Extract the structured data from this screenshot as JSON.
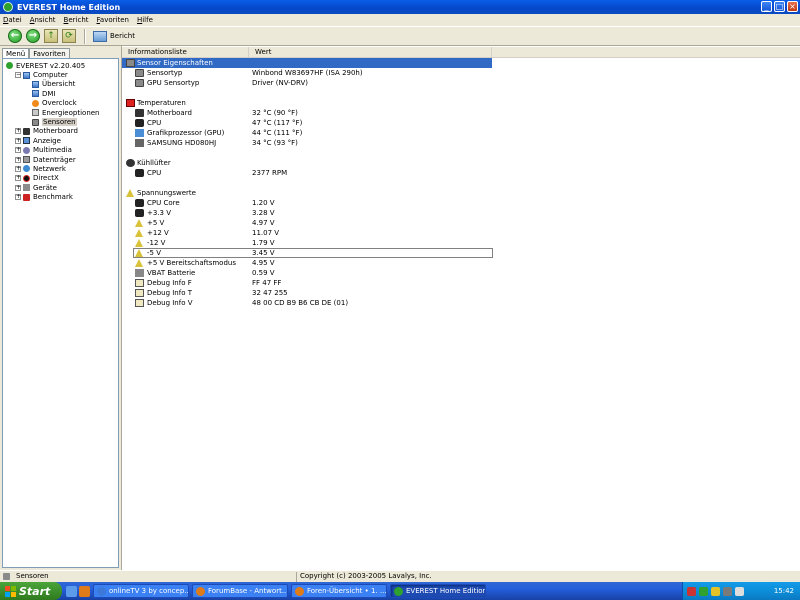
{
  "window": {
    "title": "EVEREST Home Edition",
    "min": "_",
    "max": "□",
    "close": "×"
  },
  "menu": [
    "Datei",
    "Ansicht",
    "Bericht",
    "Favoriten",
    "Hilfe"
  ],
  "toolbar": {
    "back": "←",
    "forward": "→",
    "up": "↑",
    "refresh": "⟳",
    "report_label": "Bericht"
  },
  "left_tabs": [
    "Menü",
    "Favoriten"
  ],
  "tree": [
    {
      "label": "EVEREST v2.20.405",
      "depth": 0,
      "expander": "",
      "icon": "everest-icon"
    },
    {
      "label": "Computer",
      "depth": 1,
      "expander": "−",
      "icon": "computer-icon"
    },
    {
      "label": "Übersicht",
      "depth": 2,
      "expander": "",
      "icon": "computer-icon"
    },
    {
      "label": "DMI",
      "depth": 2,
      "expander": "",
      "icon": "computer-icon"
    },
    {
      "label": "Overclock",
      "depth": 2,
      "expander": "",
      "icon": "overclock-icon"
    },
    {
      "label": "Energieoptionen",
      "depth": 2,
      "expander": "",
      "icon": "power-icon"
    },
    {
      "label": "Sensoren",
      "depth": 2,
      "expander": "",
      "icon": "sensor-icon",
      "selected": true
    },
    {
      "label": "Motherboard",
      "depth": 1,
      "expander": "+",
      "icon": "motherboard-icon"
    },
    {
      "label": "Anzeige",
      "depth": 1,
      "expander": "+",
      "icon": "display-icon"
    },
    {
      "label": "Multimedia",
      "depth": 1,
      "expander": "+",
      "icon": "multimedia-icon"
    },
    {
      "label": "Datenträger",
      "depth": 1,
      "expander": "+",
      "icon": "storage-icon"
    },
    {
      "label": "Netzwerk",
      "depth": 1,
      "expander": "+",
      "icon": "network-icon"
    },
    {
      "label": "DirectX",
      "depth": 1,
      "expander": "+",
      "icon": "directx-icon"
    },
    {
      "label": "Geräte",
      "depth": 1,
      "expander": "+",
      "icon": "devices-icon"
    },
    {
      "label": "Benchmark",
      "depth": 1,
      "expander": "+",
      "icon": "benchmark-icon"
    }
  ],
  "list_headers": {
    "field": "Informationsliste",
    "value": "Wert"
  },
  "sections": [
    {
      "title": "Sensor Eigenschaften",
      "icon": "sensor-icon",
      "selected": true,
      "rows": [
        {
          "name": "Sensortyp",
          "value": "Winbond W83697HF  (ISA 290h)",
          "icon": "sensor-icon"
        },
        {
          "name": "GPU Sensortyp",
          "value": "Driver  (NV-DRV)",
          "icon": "sensor-icon"
        }
      ]
    },
    {
      "title": "Temperaturen",
      "icon": "thermometer-icon",
      "rows": [
        {
          "name": "Motherboard",
          "value": "32 °C  (90 °F)",
          "icon": "motherboard-icon"
        },
        {
          "name": "CPU",
          "value": "47 °C  (117 °F)",
          "icon": "cpu-icon"
        },
        {
          "name": "Grafikprozessor (GPU)",
          "value": "44 °C  (111 °F)",
          "icon": "gpu-icon"
        },
        {
          "name": "SAMSUNG HD080HJ",
          "value": "34 °C  (93 °F)",
          "icon": "disk-icon"
        }
      ]
    },
    {
      "title": "Kühllüfter",
      "icon": "fan-icon",
      "rows": [
        {
          "name": "CPU",
          "value": "2377 RPM",
          "icon": "cpu-icon"
        }
      ]
    },
    {
      "title": "Spannungswerte",
      "icon": "warning-icon",
      "rows": [
        {
          "name": "CPU Core",
          "value": "1.20 V",
          "icon": "cpu-icon"
        },
        {
          "name": "+3.3 V",
          "value": "3.28 V",
          "icon": "cpu-icon"
        },
        {
          "name": "+5 V",
          "value": "4.97 V",
          "icon": "warning-icon"
        },
        {
          "name": "+12 V",
          "value": "11.07 V",
          "icon": "warning-icon"
        },
        {
          "name": "-12 V",
          "value": "1.79 V",
          "icon": "warning-icon"
        },
        {
          "name": "-5 V",
          "value": "3.45 V",
          "icon": "warning-icon",
          "focused": true
        },
        {
          "name": "+5 V Bereitschaftsmodus",
          "value": "4.95 V",
          "icon": "warning-icon"
        },
        {
          "name": "VBAT Batterie",
          "value": "0.59 V",
          "icon": "battery-icon"
        },
        {
          "name": "Debug Info F",
          "value": "FF 47 FF",
          "icon": "debug-icon"
        },
        {
          "name": "Debug Info T",
          "value": "32 47 255",
          "icon": "debug-icon"
        },
        {
          "name": "Debug Info V",
          "value": "48 00 CD B9 B6 CB DE (01)",
          "icon": "debug-icon"
        }
      ]
    }
  ],
  "status": {
    "left": "Sensoren",
    "right": "Copyright (c) 2003-2005 Lavalys, Inc."
  },
  "taskbar": {
    "start": "Start",
    "tasks": [
      {
        "label": "onlineTV 3 by concep...",
        "icon": "tv-icon",
        "color": "#3b78d8"
      },
      {
        "label": "ForumBase - Antwort...",
        "icon": "firefox-icon",
        "color": "#e07b1a"
      },
      {
        "label": "Foren-Übersicht • 1. ...",
        "icon": "firefox-icon",
        "color": "#e07b1a"
      },
      {
        "label": "EVEREST Home Edition",
        "icon": "everest-icon",
        "color": "#2ea12e",
        "active": true
      }
    ],
    "clock": "15:42"
  }
}
